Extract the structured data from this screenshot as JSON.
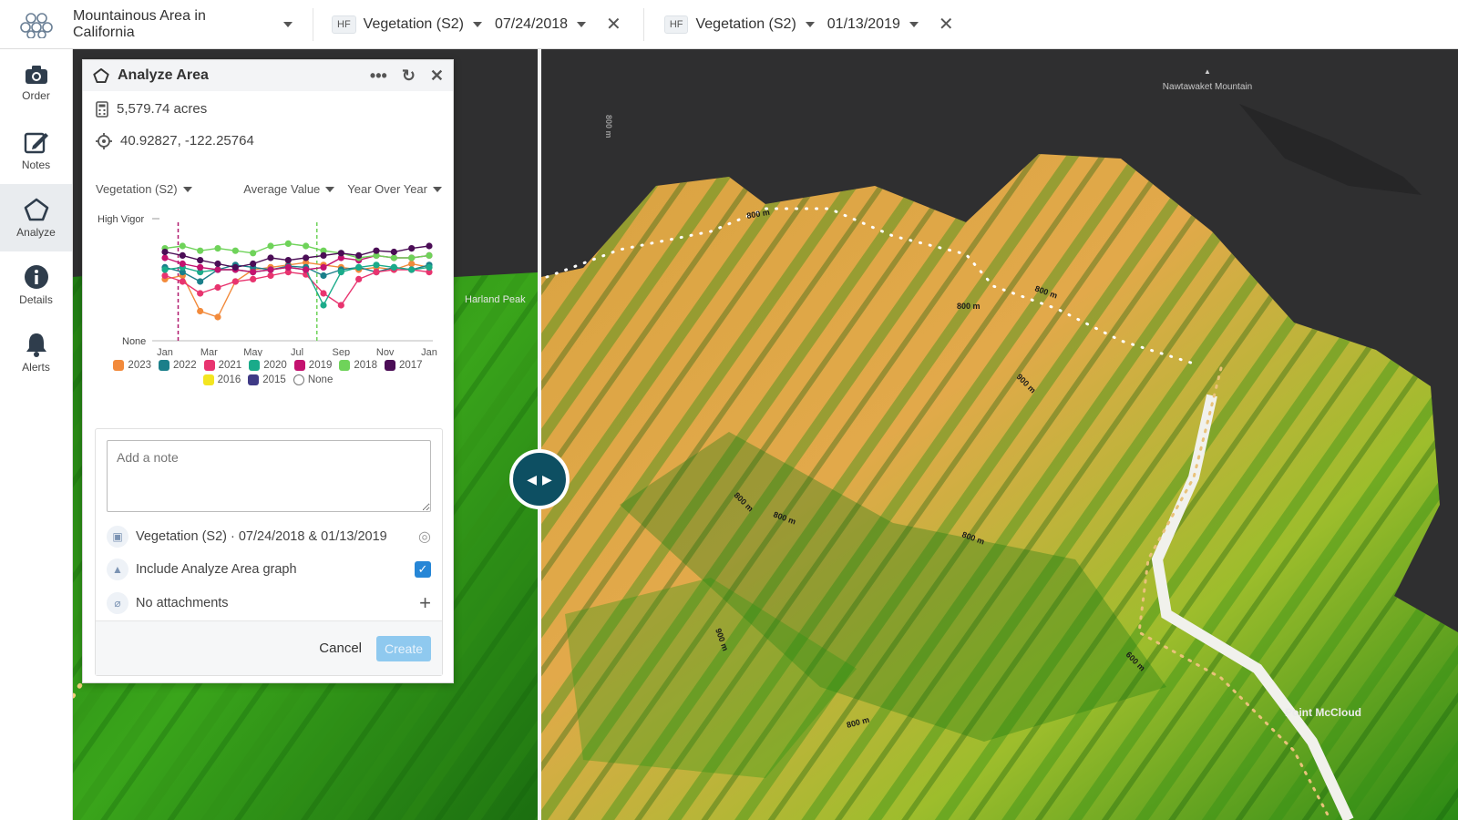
{
  "topbar": {
    "area_title": "Mountainous Area in California",
    "left_layer": {
      "badge": "HF",
      "name": "Vegetation (S2)",
      "date": "07/24/2018"
    },
    "right_layer": {
      "badge": "HF",
      "name": "Vegetation (S2)",
      "date": "01/13/2019"
    }
  },
  "sidebar": {
    "items": [
      {
        "label": "Order",
        "icon": "camera-icon"
      },
      {
        "label": "Notes",
        "icon": "pencil-icon"
      },
      {
        "label": "Analyze",
        "icon": "pentagon-icon",
        "active": true
      },
      {
        "label": "Details",
        "icon": "info-icon"
      },
      {
        "label": "Alerts",
        "icon": "bell-icon"
      }
    ]
  },
  "panel": {
    "title": "Analyze Area",
    "area": "5,579.74 acres",
    "coords": "40.92827, -122.25764",
    "dropdowns": {
      "layer": "Vegetation (S2)",
      "metric": "Average Value",
      "mode": "Year Over Year"
    },
    "chart_data": {
      "type": "line",
      "ylabel_top": "High Vigor",
      "ylabel_bottom": "None",
      "x_ticks": [
        "Jan",
        "Mar",
        "May",
        "Jul",
        "Sep",
        "Nov",
        "Jan"
      ],
      "series": [
        {
          "name": "2023",
          "color": "#f28a3b",
          "values": [
            0.52,
            0.55,
            0.25,
            0.2,
            0.5,
            0.6,
            0.62,
            0.64,
            0.66,
            0.64,
            0.62,
            0.6,
            0.62,
            0.6,
            0.65,
            0.62
          ]
        },
        {
          "name": "2022",
          "color": "#1b7f8a",
          "values": [
            0.62,
            0.58,
            0.5,
            0.6,
            0.64,
            0.62,
            0.6,
            0.63,
            0.62,
            0.55,
            0.6,
            0.62,
            0.58,
            0.62,
            0.6,
            0.64
          ]
        },
        {
          "name": "2021",
          "color": "#e8346f",
          "values": [
            0.55,
            0.5,
            0.4,
            0.45,
            0.5,
            0.52,
            0.55,
            0.58,
            0.56,
            0.4,
            0.3,
            0.52,
            0.58,
            0.6,
            0.6,
            0.58
          ]
        },
        {
          "name": "2020",
          "color": "#1aab8a",
          "values": [
            0.6,
            0.62,
            0.58,
            0.6,
            0.6,
            0.58,
            0.6,
            0.62,
            0.6,
            0.3,
            0.58,
            0.62,
            0.64,
            0.62,
            0.6,
            0.62
          ]
        },
        {
          "name": "2019",
          "color": "#c4126f",
          "values": [
            0.7,
            0.65,
            0.62,
            0.6,
            0.6,
            0.58,
            0.6,
            0.62,
            0.6,
            0.62,
            0.7,
            0.68,
            0.72,
            0.7,
            0.7,
            0.72
          ]
        },
        {
          "name": "2018",
          "color": "#6fd35a",
          "values": [
            0.78,
            0.8,
            0.76,
            0.78,
            0.76,
            0.74,
            0.8,
            0.82,
            0.8,
            0.76,
            0.74,
            0.7,
            0.72,
            0.7,
            0.7,
            0.72
          ]
        },
        {
          "name": "2017",
          "color": "#4b0d56",
          "values": [
            0.75,
            0.72,
            0.68,
            0.65,
            0.62,
            0.65,
            0.7,
            0.68,
            0.7,
            0.72,
            0.74,
            0.72,
            0.76,
            0.75,
            0.78,
            0.8
          ]
        }
      ],
      "extra_legend": [
        {
          "name": "2016",
          "color": "#f3e520"
        },
        {
          "name": "2015",
          "color": "#3f3a86"
        },
        {
          "name": "None",
          "color": "none"
        }
      ],
      "markers": [
        {
          "month": 0.6,
          "color": "#b0186e"
        },
        {
          "month": 6.9,
          "color": "#6fd35a"
        }
      ]
    },
    "note": {
      "placeholder": "Add a note",
      "imagery_line": "Vegetation (S2) · 07/24/2018 & 01/13/2019",
      "include_graph": "Include Analyze Area graph",
      "attachments": "No attachments",
      "cancel": "Cancel",
      "create": "Create"
    }
  },
  "map_labels": {
    "mountain": "Nawtawaket Mountain",
    "peak": "Harland Peak",
    "point": "Point McCloud",
    "contours": [
      "800 m",
      "800 m",
      "800 m",
      "900 m",
      "800 m",
      "800 m",
      "800 m",
      "900 m",
      "800 m",
      "600 m",
      "800 m"
    ]
  }
}
